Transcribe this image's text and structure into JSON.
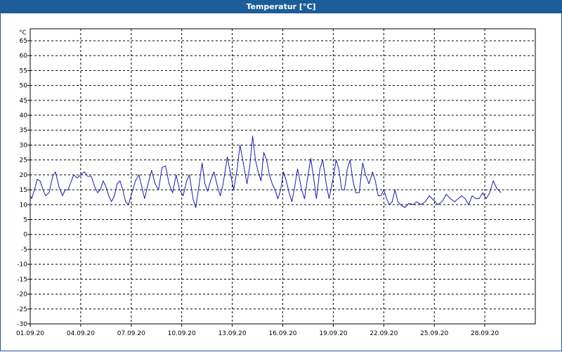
{
  "window": {
    "title": "Temperatur [°C]"
  },
  "chart_data": {
    "type": "line",
    "title": "Temperatur [°C]",
    "ylabel": "°C",
    "ylim": [
      -30,
      69
    ],
    "yticks": [
      -30,
      -25,
      -20,
      -15,
      -10,
      -5,
      0,
      5,
      10,
      15,
      20,
      25,
      30,
      35,
      40,
      45,
      50,
      55,
      60,
      65
    ],
    "xlim": [
      "01.09.20",
      "01.10.20"
    ],
    "xticks": [
      "01.09.20",
      "04.09.20",
      "07.09.20",
      "10.09.20",
      "13.09.20",
      "16.09.20",
      "19.09.20",
      "22.09.20",
      "25.09.20",
      "28.09.20"
    ],
    "grid": true,
    "line_color": "#1a1aa8",
    "series": [
      {
        "values": [
          [
            "01.09.20 00:00",
            13
          ],
          [
            "01.09.20 02:00",
            12
          ],
          [
            "01.09.20 06:00",
            15
          ],
          [
            "01.09.20 10:00",
            18.5
          ],
          [
            "01.09.20 14:00",
            18
          ],
          [
            "01.09.20 19:00",
            14.5
          ],
          [
            "01.09.20 22:00",
            13
          ],
          [
            "02.09.20 03:00",
            14
          ],
          [
            "02.09.20 08:00",
            19.5
          ],
          [
            "02.09.20 12:00",
            21
          ],
          [
            "02.09.20 17:00",
            16
          ],
          [
            "02.09.20 22:00",
            13
          ],
          [
            "03.09.20 02:00",
            15
          ],
          [
            "03.09.20 06:00",
            15
          ],
          [
            "03.09.20 10:00",
            17.5
          ],
          [
            "03.09.20 14:00",
            20
          ],
          [
            "03.09.20 19:00",
            19
          ],
          [
            "04.09.20 00:00",
            20
          ],
          [
            "04.09.20 05:00",
            21
          ],
          [
            "04.09.20 10:00",
            19.5
          ],
          [
            "04.09.20 15:00",
            19.5
          ],
          [
            "04.09.20 20:00",
            16
          ],
          [
            "05.09.20 00:00",
            14
          ],
          [
            "05.09.20 04:00",
            15
          ],
          [
            "05.09.20 08:00",
            18
          ],
          [
            "05.09.20 12:00",
            16
          ],
          [
            "05.09.20 16:00",
            13
          ],
          [
            "05.09.20 20:00",
            11
          ],
          [
            "06.09.20 00:00",
            13
          ],
          [
            "06.09.20 04:00",
            17
          ],
          [
            "06.09.20 08:00",
            18
          ],
          [
            "06.09.20 12:00",
            15
          ],
          [
            "06.09.20 16:00",
            11
          ],
          [
            "06.09.20 20:00",
            10
          ],
          [
            "07.09.20 01:00",
            14
          ],
          [
            "07.09.20 06:00",
            18
          ],
          [
            "07.09.20 11:00",
            20
          ],
          [
            "07.09.20 15:00",
            16
          ],
          [
            "07.09.20 19:00",
            12
          ],
          [
            "08.09.20 00:00",
            17
          ],
          [
            "08.09.20 05:00",
            21.5
          ],
          [
            "08.09.20 10:00",
            17
          ],
          [
            "08.09.20 15:00",
            15
          ],
          [
            "08.09.20 20:00",
            22.5
          ],
          [
            "09.09.20 01:00",
            23
          ],
          [
            "09.09.20 06:00",
            17
          ],
          [
            "09.09.20 11:00",
            14
          ],
          [
            "09.09.20 16:00",
            20
          ],
          [
            "09.09.20 21:00",
            15
          ],
          [
            "10.09.20 02:00",
            13
          ],
          [
            "10.09.20 07:00",
            18
          ],
          [
            "10.09.20 11:00",
            20
          ],
          [
            "10.09.20 16:00",
            12
          ],
          [
            "10.09.20 20:00",
            9
          ],
          [
            "11.09.20 01:00",
            17
          ],
          [
            "11.09.20 05:00",
            24
          ],
          [
            "11.09.20 09:00",
            17
          ],
          [
            "11.09.20 13:00",
            14.5
          ],
          [
            "11.09.20 17:00",
            18
          ],
          [
            "11.09.20 22:00",
            21
          ],
          [
            "12.09.20 03:00",
            16
          ],
          [
            "12.09.20 07:00",
            13
          ],
          [
            "12.09.20 11:00",
            17
          ],
          [
            "12.09.20 17:00",
            26
          ],
          [
            "12.09.20 21:00",
            21
          ],
          [
            "13.09.20 02:00",
            15
          ],
          [
            "13.09.20 07:00",
            22
          ],
          [
            "13.09.20 11:00",
            30
          ],
          [
            "13.09.20 15:00",
            25
          ],
          [
            "13.09.20 18:00",
            21
          ],
          [
            "13.09.20 21:00",
            17
          ],
          [
            "14.09.20 01:00",
            23
          ],
          [
            "14.09.20 05:00",
            33
          ],
          [
            "14.09.20 09:00",
            25
          ],
          [
            "14.09.20 13:00",
            21
          ],
          [
            "14.09.20 17:00",
            18
          ],
          [
            "14.09.20 21:00",
            27.5
          ],
          [
            "15.09.20 01:00",
            25
          ],
          [
            "15.09.20 05:00",
            20
          ],
          [
            "15.09.20 09:00",
            17
          ],
          [
            "15.09.20 13:00",
            15
          ],
          [
            "15.09.20 17:00",
            12
          ],
          [
            "15.09.20 21:00",
            15
          ],
          [
            "16.09.20 01:00",
            21
          ],
          [
            "16.09.20 05:00",
            18
          ],
          [
            "16.09.20 09:00",
            14
          ],
          [
            "16.09.20 13:00",
            11
          ],
          [
            "16.09.20 17:00",
            16
          ],
          [
            "16.09.20 21:00",
            22
          ],
          [
            "17.09.20 03:00",
            15
          ],
          [
            "17.09.20 07:00",
            12
          ],
          [
            "17.09.20 12:00",
            20
          ],
          [
            "17.09.20 16:00",
            25.5
          ],
          [
            "17.09.20 20:00",
            19
          ],
          [
            "18.09.20 00:00",
            12
          ],
          [
            "18.09.20 05:00",
            22
          ],
          [
            "18.09.20 09:00",
            25
          ],
          [
            "18.09.20 14:00",
            17
          ],
          [
            "18.09.20 18:00",
            12
          ],
          [
            "19.09.20 00:00",
            19
          ],
          [
            "19.09.20 04:00",
            25
          ],
          [
            "19.09.20 08:00",
            22
          ],
          [
            "19.09.20 12:00",
            15
          ],
          [
            "19.09.20 16:00",
            15
          ],
          [
            "19.09.20 20:00",
            22
          ],
          [
            "20.09.20 00:00",
            25
          ],
          [
            "20.09.20 04:00",
            18
          ],
          [
            "20.09.20 08:00",
            14
          ],
          [
            "20.09.20 13:00",
            14
          ],
          [
            "20.09.20 18:00",
            24
          ],
          [
            "20.09.20 22:00",
            20
          ],
          [
            "21.09.20 03:00",
            17
          ],
          [
            "21.09.20 08:00",
            21
          ],
          [
            "21.09.20 12:00",
            18
          ],
          [
            "21.09.20 16:00",
            13
          ],
          [
            "21.09.20 20:00",
            13
          ],
          [
            "22.09.20 00:00",
            15
          ],
          [
            "22.09.20 04:00",
            12
          ],
          [
            "22.09.20 08:00",
            10
          ],
          [
            "22.09.20 12:00",
            11
          ],
          [
            "22.09.20 16:00",
            15
          ],
          [
            "22.09.20 20:00",
            11
          ],
          [
            "23.09.20 00:00",
            10
          ],
          [
            "23.09.20 06:00",
            9
          ],
          [
            "23.09.20 12:00",
            10.5
          ],
          [
            "23.09.20 18:00",
            10
          ],
          [
            "23.09.20 23:00",
            11
          ],
          [
            "24.09.20 05:00",
            10
          ],
          [
            "24.09.20 11:00",
            11
          ],
          [
            "24.09.20 17:00",
            13
          ],
          [
            "24.09.20 23:00",
            11.5
          ],
          [
            "25.09.20 05:00",
            10
          ],
          [
            "25.09.20 11:00",
            11
          ],
          [
            "25.09.20 17:00",
            13.5
          ],
          [
            "25.09.20 23:00",
            12
          ],
          [
            "26.09.20 05:00",
            11
          ],
          [
            "26.09.20 10:00",
            12
          ],
          [
            "26.09.20 15:00",
            13
          ],
          [
            "26.09.20 20:00",
            12
          ],
          [
            "27.09.20 01:00",
            10
          ],
          [
            "27.09.20 06:00",
            13
          ],
          [
            "27.09.20 11:00",
            12
          ],
          [
            "27.09.20 16:00",
            12
          ],
          [
            "27.09.20 21:00",
            14
          ],
          [
            "28.09.20 02:00",
            12
          ],
          [
            "28.09.20 07:00",
            14
          ],
          [
            "28.09.20 12:00",
            18
          ],
          [
            "28.09.20 17:00",
            15.5
          ],
          [
            "28.09.20 23:00",
            14
          ]
        ]
      }
    ]
  }
}
